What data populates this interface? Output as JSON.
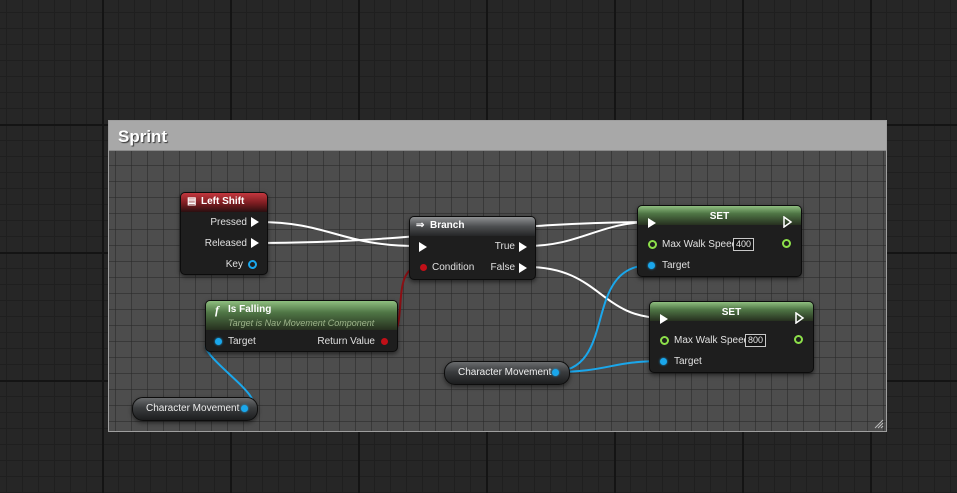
{
  "comment": {
    "title": "Sprint"
  },
  "nodes": {
    "left_shift": {
      "title": "Left Shift",
      "icon": "keyboard-event-icon",
      "pins": {
        "pressed": "Pressed",
        "released": "Released",
        "key": "Key"
      }
    },
    "branch": {
      "title": "Branch",
      "icon": "branch-icon",
      "pins": {
        "condition": "Condition",
        "true": "True",
        "false": "False"
      }
    },
    "set_top": {
      "title": "SET",
      "pins": {
        "max_walk_speed": "Max Walk Speed",
        "target": "Target"
      },
      "max_walk_speed_value": "400"
    },
    "set_bottom": {
      "title": "SET",
      "pins": {
        "max_walk_speed": "Max Walk Speed",
        "target": "Target"
      },
      "max_walk_speed_value": "800"
    },
    "is_falling": {
      "title": "Is Falling",
      "subtitle": "Target is Nav Movement Component",
      "icon": "function-icon",
      "pins": {
        "target": "Target",
        "return_value": "Return Value"
      }
    },
    "char_movement_left": {
      "label": "Character Movement"
    },
    "char_movement_right": {
      "label": "Character Movement"
    }
  },
  "colors": {
    "exec_wire": "#ffffff",
    "object_wire": "#1aa7ec",
    "bool_wire": "#8b0f14",
    "float_pin": "#8de04a"
  }
}
